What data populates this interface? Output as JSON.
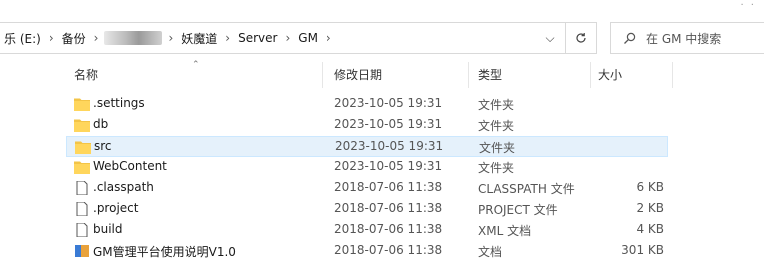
{
  "address_bar": {
    "crumbs": [
      "乐 (E:)",
      "备份",
      "",
      "妖魔道",
      "Server",
      "GM"
    ],
    "redacted_segment": true
  },
  "search": {
    "placeholder": "在 GM 中搜索"
  },
  "columns": {
    "name": "名称",
    "date": "修改日期",
    "type": "类型",
    "size": "大小"
  },
  "files": [
    {
      "name": ".settings",
      "date": "2023-10-05 19:31",
      "type": "文件夹",
      "size": "",
      "icon": "folder-icon",
      "selected": false
    },
    {
      "name": "db",
      "date": "2023-10-05 19:31",
      "type": "文件夹",
      "size": "",
      "icon": "folder-icon",
      "selected": false
    },
    {
      "name": "src",
      "date": "2023-10-05 19:31",
      "type": "文件夹",
      "size": "",
      "icon": "folder-icon",
      "selected": true
    },
    {
      "name": "WebContent",
      "date": "2023-10-05 19:31",
      "type": "文件夹",
      "size": "",
      "icon": "folder-icon",
      "selected": false
    },
    {
      "name": ".classpath",
      "date": "2018-07-06 11:38",
      "type": "CLASSPATH 文件",
      "size": "6 KB",
      "icon": "file-icon",
      "selected": false
    },
    {
      "name": ".project",
      "date": "2018-07-06 11:38",
      "type": "PROJECT 文件",
      "size": "2 KB",
      "icon": "file-icon",
      "selected": false
    },
    {
      "name": "build",
      "date": "2018-07-06 11:38",
      "type": "XML 文档",
      "size": "4 KB",
      "icon": "file-icon",
      "selected": false
    },
    {
      "name": "GM管理平台使用说明V1.0",
      "date": "2018-07-06 11:38",
      "type": "文档",
      "size": "301 KB",
      "icon": "doc-icon",
      "selected": false
    }
  ]
}
